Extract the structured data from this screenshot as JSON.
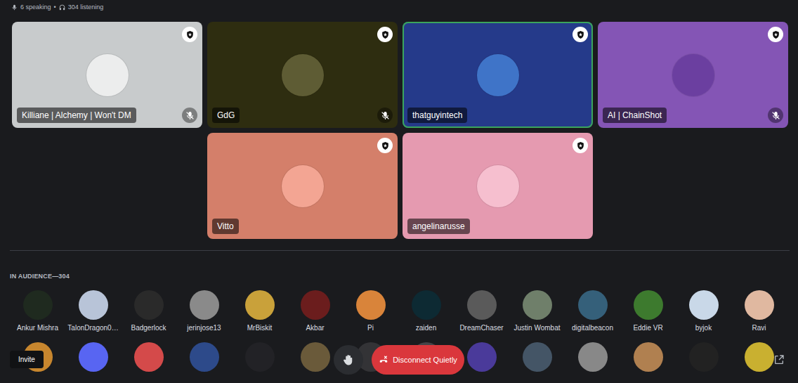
{
  "header": {
    "speaking": "6 speaking",
    "separator": "•",
    "listening": "304 listening"
  },
  "speakers": [
    {
      "name": "Killiane | Alchemy | Won't DM",
      "color": "#c8cbcc",
      "avatar_color": "#eceded",
      "moderator": true,
      "muted": true,
      "speaking": false
    },
    {
      "name": "GdG",
      "color": "#2e2d10",
      "avatar_color": "#5e5c34",
      "moderator": true,
      "muted": true,
      "speaking": false
    },
    {
      "name": "thatguyintech",
      "color": "#253a8a",
      "avatar_color": "#3f74c8",
      "moderator": true,
      "muted": false,
      "speaking": true
    },
    {
      "name": "AI | ChainShot",
      "color": "#8455b5",
      "avatar_color": "#6b3fa0",
      "moderator": true,
      "muted": true,
      "speaking": false
    },
    {
      "name": "Vitto",
      "color": "#d47f6a",
      "avatar_color": "#f3a593",
      "moderator": true,
      "muted": false,
      "speaking": false
    },
    {
      "name": "angelinarusse",
      "color": "#e59ab0",
      "avatar_color": "#f6bfcf",
      "moderator": true,
      "muted": false,
      "speaking": false
    }
  ],
  "audience": {
    "heading": "IN AUDIENCE—304",
    "members": [
      {
        "name": "Ankur Mishra",
        "color": "#1f2a1f"
      },
      {
        "name": "TalonDragon0…",
        "color": "#b8c4d8"
      },
      {
        "name": "Badgerlock",
        "color": "#2a2a2a"
      },
      {
        "name": "jerinjose13",
        "color": "#8a8a8a"
      },
      {
        "name": "MrBiskit",
        "color": "#c9a13a"
      },
      {
        "name": "Akbar",
        "color": "#6b1d1d"
      },
      {
        "name": "Pi",
        "color": "#d9843a"
      },
      {
        "name": "zaiden",
        "color": "#0d2a33"
      },
      {
        "name": "DreamChaser",
        "color": "#5a5a5a"
      },
      {
        "name": "Justin Wombat",
        "color": "#6f7f6a"
      },
      {
        "name": "digitalbeacon",
        "color": "#35607a"
      },
      {
        "name": "Eddie VR",
        "color": "#3d7a2e"
      },
      {
        "name": "byjok",
        "color": "#c9d8e8"
      },
      {
        "name": "Ravi",
        "color": "#e0b8a0"
      }
    ],
    "members_cut": [
      {
        "color": "#c7862e"
      },
      {
        "color": "#5865f2"
      },
      {
        "color": "#d44a4a"
      },
      {
        "color": "#2d4a8a"
      },
      {
        "color": "#222226"
      },
      {
        "color": "#6a5a3a"
      },
      {
        "color": "#333336"
      },
      {
        "color": "#444448"
      },
      {
        "color": "#4a3a9a"
      },
      {
        "color": "#445566"
      },
      {
        "color": "#888888"
      },
      {
        "color": "#b08050"
      },
      {
        "color": "#222222"
      },
      {
        "color": "#c9b030"
      }
    ]
  },
  "controls": {
    "invite": "Invite",
    "disconnect": "Disconnect Quietly"
  }
}
